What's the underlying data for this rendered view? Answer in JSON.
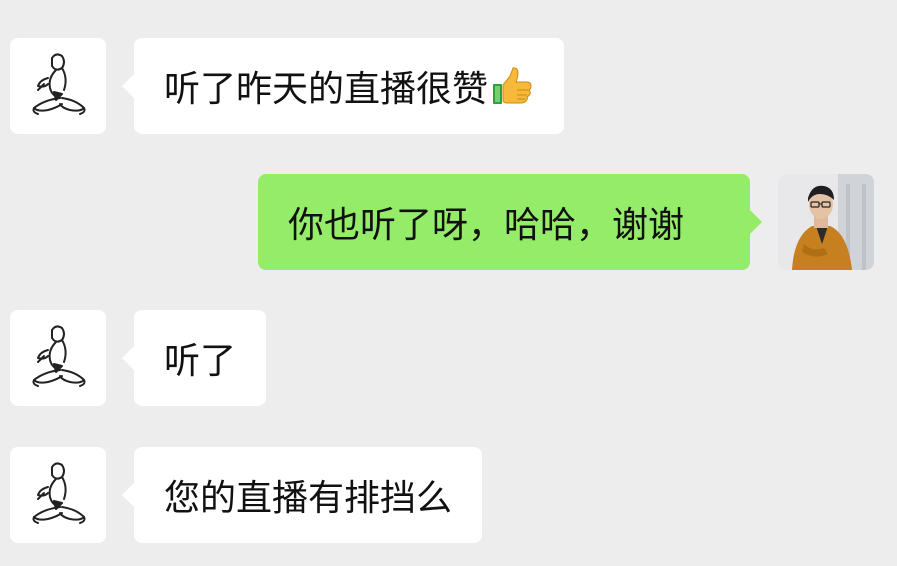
{
  "messages": [
    {
      "side": "incoming",
      "text": "听了昨天的直播很赞",
      "emoji": "thumbs-up-icon"
    },
    {
      "side": "outgoing",
      "text": "你也听了呀，哈哈，谢谢"
    },
    {
      "side": "incoming",
      "text": "听了"
    },
    {
      "side": "incoming",
      "text": "您的直播有排挡么"
    }
  ],
  "colors": {
    "background": "#ededed",
    "incoming_bubble": "#ffffff",
    "outgoing_bubble": "#95ec69",
    "text": "#111111"
  }
}
